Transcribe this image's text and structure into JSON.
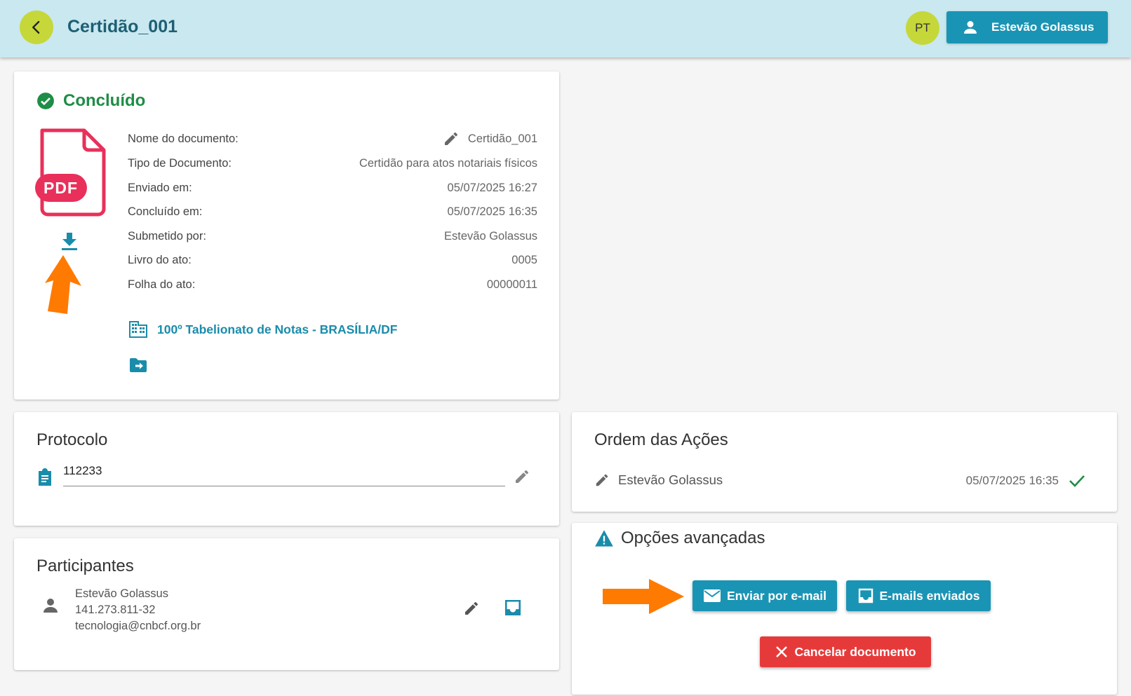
{
  "header": {
    "title": "Certidão_001",
    "language": "PT",
    "user_name": "Estevão Golassus"
  },
  "document": {
    "status": "Concluído",
    "pdf_label": "PDF",
    "fields": [
      {
        "label": "Nome do documento:",
        "value": "Certidão_001"
      },
      {
        "label": "Tipo de Documento:",
        "value": "Certidão para atos notariais físicos"
      },
      {
        "label": "Enviado em:",
        "value": "05/07/2025 16:27"
      },
      {
        "label": "Concluído em:",
        "value": "05/07/2025 16:35"
      },
      {
        "label": "Submetido por:",
        "value": "Estevão Golassus"
      },
      {
        "label": "Livro do ato:",
        "value": "0005"
      },
      {
        "label": "Folha do ato:",
        "value": "00000011"
      }
    ],
    "office": "100º Tabelionato de Notas - BRASÍLIA/DF"
  },
  "protocol": {
    "title": "Protocolo",
    "value": "112233"
  },
  "participants": {
    "title": "Participantes",
    "items": [
      {
        "name": "Estevão Golassus",
        "cpf": "141.273.811-32",
        "email": "tecnologia@cnbcf.org.br"
      }
    ]
  },
  "actions_order": {
    "title": "Ordem das Ações",
    "items": [
      {
        "name": "Estevão Golassus",
        "date": "05/07/2025 16:35"
      }
    ]
  },
  "advanced": {
    "title": "Opções avançadas",
    "send_email_label": "Enviar por e-mail",
    "sent_emails_label": "E-mails enviados",
    "cancel_label": "Cancelar documento"
  },
  "colors": {
    "primary": "#1a94b4",
    "accent": "#c6d73a",
    "success": "#1e8d46",
    "danger": "#e63a3a",
    "annotation_arrow": "#ff7a00",
    "pdf": "#e8305a"
  }
}
